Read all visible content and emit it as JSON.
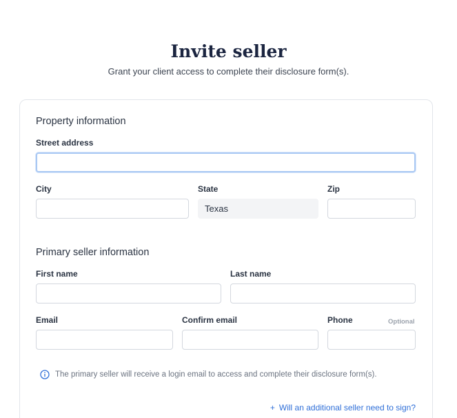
{
  "header": {
    "title": "Invite seller",
    "subtitle": "Grant your client access to complete their disclosure form(s)."
  },
  "property": {
    "section_title": "Property information",
    "street": {
      "label": "Street address",
      "value": "",
      "placeholder": ""
    },
    "city": {
      "label": "City",
      "value": ""
    },
    "state": {
      "label": "State",
      "value": "Texas"
    },
    "zip": {
      "label": "Zip",
      "value": ""
    }
  },
  "seller": {
    "section_title": "Primary seller information",
    "first_name": {
      "label": "First name",
      "value": ""
    },
    "last_name": {
      "label": "Last name",
      "value": ""
    },
    "email": {
      "label": "Email",
      "value": ""
    },
    "confirm_email": {
      "label": "Confirm email",
      "value": ""
    },
    "phone": {
      "label": "Phone",
      "optional": "Optional",
      "value": ""
    }
  },
  "info": {
    "icon": "info-icon",
    "text": "The primary seller will receive a login email to access and complete their disclosure form(s)."
  },
  "add_seller": {
    "icon": "plus-icon",
    "plus": "+",
    "label": "Will an additional seller need to sign?"
  },
  "colors": {
    "accent": "#2f6fd8",
    "focus": "#a9c8f3",
    "title": "#1b2540"
  }
}
